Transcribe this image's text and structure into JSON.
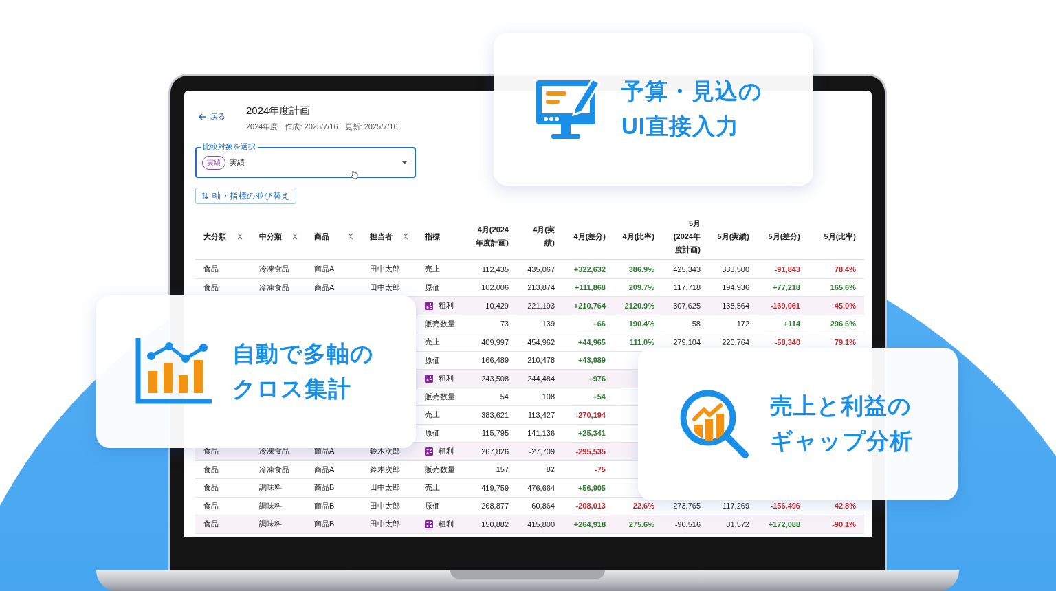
{
  "screen": {
    "back_link": "戻る",
    "title": "2024年度計画",
    "meta": [
      "2024年度",
      "作成: 2025/7/16",
      "更新: 2025/7/16"
    ],
    "compare_select": {
      "label": "比較対象を選択",
      "chips": [
        "実績"
      ],
      "value": "実績"
    },
    "sort_button": "軸・指標の並び替え",
    "table": {
      "columns": [
        {
          "label": "大分類",
          "sortable": true
        },
        {
          "label": "中分類",
          "sortable": true
        },
        {
          "label": "商品",
          "sortable": true
        },
        {
          "label": "担当者",
          "sortable": true
        },
        {
          "label": "指標",
          "sortable": false
        },
        {
          "label": "4月(2024年度計画)",
          "sortable": false
        },
        {
          "label": "4月(実績)",
          "sortable": false
        },
        {
          "label": "4月(差分)",
          "sortable": false
        },
        {
          "label": "4月(比率)",
          "sortable": false
        },
        {
          "label": "5月(2024年度計画)",
          "sortable": false
        },
        {
          "label": "5月(実績)",
          "sortable": false
        },
        {
          "label": "5月(差分)",
          "sortable": false
        },
        {
          "label": "5月(比率)",
          "sortable": false
        }
      ],
      "rows": [
        {
          "kind": "plain",
          "apr_negative": false,
          "may_negative": true,
          "cells": [
            "食品",
            "冷凍食品",
            "商品A",
            "田中太郎",
            "売上",
            "112,435",
            "435,067",
            "+322,632",
            "386.9%",
            "425,343",
            "333,500",
            "-91,843",
            "78.4%"
          ]
        },
        {
          "kind": "plain",
          "apr_negative": false,
          "may_negative": false,
          "cells": [
            "食品",
            "冷凍食品",
            "商品A",
            "田中太郎",
            "原価",
            "102,006",
            "213,874",
            "+111,868",
            "209.7%",
            "117,718",
            "194,936",
            "+77,218",
            "165.6%"
          ]
        },
        {
          "kind": "calculated",
          "apr_negative": false,
          "may_negative": true,
          "cells": [
            null,
            null,
            null,
            null,
            "粗利",
            "10,429",
            "221,193",
            "+210,764",
            "2120.9%",
            "307,625",
            "138,564",
            "-169,061",
            "45.0%"
          ]
        },
        {
          "kind": "plain",
          "apr_negative": false,
          "may_negative": false,
          "cells": [
            null,
            null,
            null,
            null,
            "販売数量",
            "73",
            "139",
            "+66",
            "190.4%",
            "58",
            "172",
            "+114",
            "296.6%"
          ]
        },
        {
          "kind": "plain",
          "apr_negative": false,
          "may_negative": true,
          "cells": [
            null,
            null,
            null,
            null,
            "売上",
            "409,997",
            "454,962",
            "+44,965",
            "111.0%",
            "279,104",
            "220,764",
            "-58,340",
            "79.1%"
          ]
        },
        {
          "kind": "plain",
          "apr_negative": false,
          "cells": [
            null,
            null,
            null,
            null,
            "原価",
            "166,489",
            "210,478",
            "+43,989",
            null,
            null,
            null,
            null,
            null
          ]
        },
        {
          "kind": "calculated",
          "apr_negative": false,
          "cells": [
            null,
            null,
            null,
            null,
            "粗利",
            "243,508",
            "244,484",
            "+976",
            null,
            null,
            null,
            null,
            null
          ]
        },
        {
          "kind": "plain",
          "apr_negative": false,
          "cells": [
            null,
            null,
            null,
            null,
            "販売数量",
            "54",
            "108",
            "+54",
            null,
            null,
            null,
            null,
            null
          ]
        },
        {
          "kind": "plain",
          "apr_negative": true,
          "cells": [
            null,
            null,
            null,
            null,
            "売上",
            "383,621",
            "113,427",
            "-270,194",
            null,
            null,
            null,
            null,
            null
          ]
        },
        {
          "kind": "plain",
          "apr_negative": false,
          "cells": [
            null,
            null,
            null,
            null,
            "原価",
            "115,795",
            "141,136",
            "+25,341",
            null,
            null,
            null,
            null,
            null
          ]
        },
        {
          "kind": "calculated",
          "apr_negative": true,
          "cells": [
            "食品",
            "冷凍食品",
            "商品A",
            "鈴木次郎",
            "粗利",
            "267,826",
            "-27,709",
            "-295,535",
            null,
            null,
            null,
            null,
            null
          ]
        },
        {
          "kind": "plain",
          "apr_negative": true,
          "cells": [
            "食品",
            "冷凍食品",
            "商品A",
            "鈴木次郎",
            "販売数量",
            "157",
            "82",
            "-75",
            null,
            null,
            null,
            null,
            null
          ]
        },
        {
          "kind": "plain",
          "apr_negative": false,
          "cells": [
            "食品",
            "調味料",
            "商品B",
            "田中太郎",
            "売上",
            "419,759",
            "476,664",
            "+56,905",
            null,
            null,
            null,
            null,
            null
          ]
        },
        {
          "kind": "plain",
          "apr_negative": true,
          "may_negative": true,
          "cells": [
            "食品",
            "調味料",
            "商品B",
            "田中太郎",
            "原価",
            "268,877",
            "60,864",
            "-208,013",
            "22.6%",
            "273,765",
            "117,269",
            "-156,496",
            "42.8%"
          ]
        },
        {
          "kind": "calculated",
          "apr_negative": false,
          "may_negative": false,
          "may_ratio_negative": true,
          "cells": [
            "食品",
            "調味料",
            "商品B",
            "田中太郎",
            "粗利",
            "150,882",
            "415,800",
            "+264,918",
            "275.6%",
            "-90,516",
            "81,572",
            "+172,088",
            "-90.1%"
          ]
        }
      ]
    }
  },
  "feature_cards": [
    {
      "kind": "input",
      "lines": [
        "予算・見込の",
        "UI直接入力"
      ]
    },
    {
      "kind": "crosstab",
      "lines": [
        "自動で多軸の",
        "クロス集計"
      ]
    },
    {
      "kind": "gap",
      "lines": [
        "売上と利益の",
        "ギャップ分析"
      ]
    }
  ]
}
